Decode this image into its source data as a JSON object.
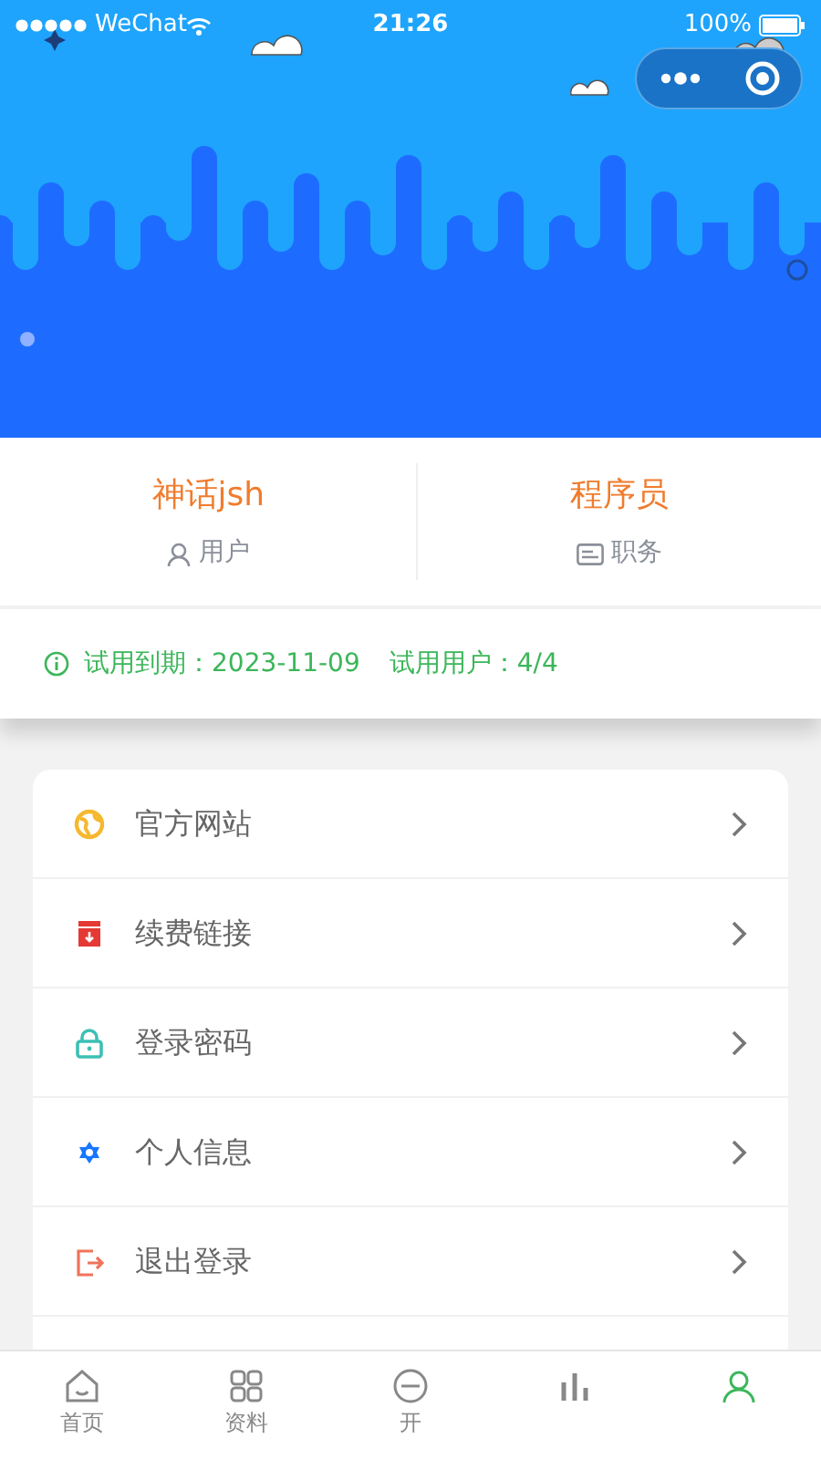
{
  "status_bar": {
    "carrier": "WeChat",
    "time": "21:26",
    "battery": "100%"
  },
  "profile": {
    "name": "神话jsh",
    "name_label": "用户",
    "role": "程序员",
    "role_label": "职务"
  },
  "trial": {
    "expiry": "试用到期：2023-11-09",
    "users": "试用用户：4/4"
  },
  "menu": [
    {
      "label": "官方网站",
      "color": "#f5b82e"
    },
    {
      "label": "续费链接",
      "color": "#e53935"
    },
    {
      "label": "登录密码",
      "color": "#3cc0b5"
    },
    {
      "label": "个人信息",
      "color": "#1677ff"
    },
    {
      "label": "退出登录",
      "color": "#f0735a"
    }
  ],
  "tabs": [
    {
      "label": "首页",
      "selected": false
    },
    {
      "label": "资料",
      "selected": false
    },
    {
      "label": "开",
      "selected": false
    },
    {
      "selected": false
    },
    {
      "selected": true
    }
  ]
}
